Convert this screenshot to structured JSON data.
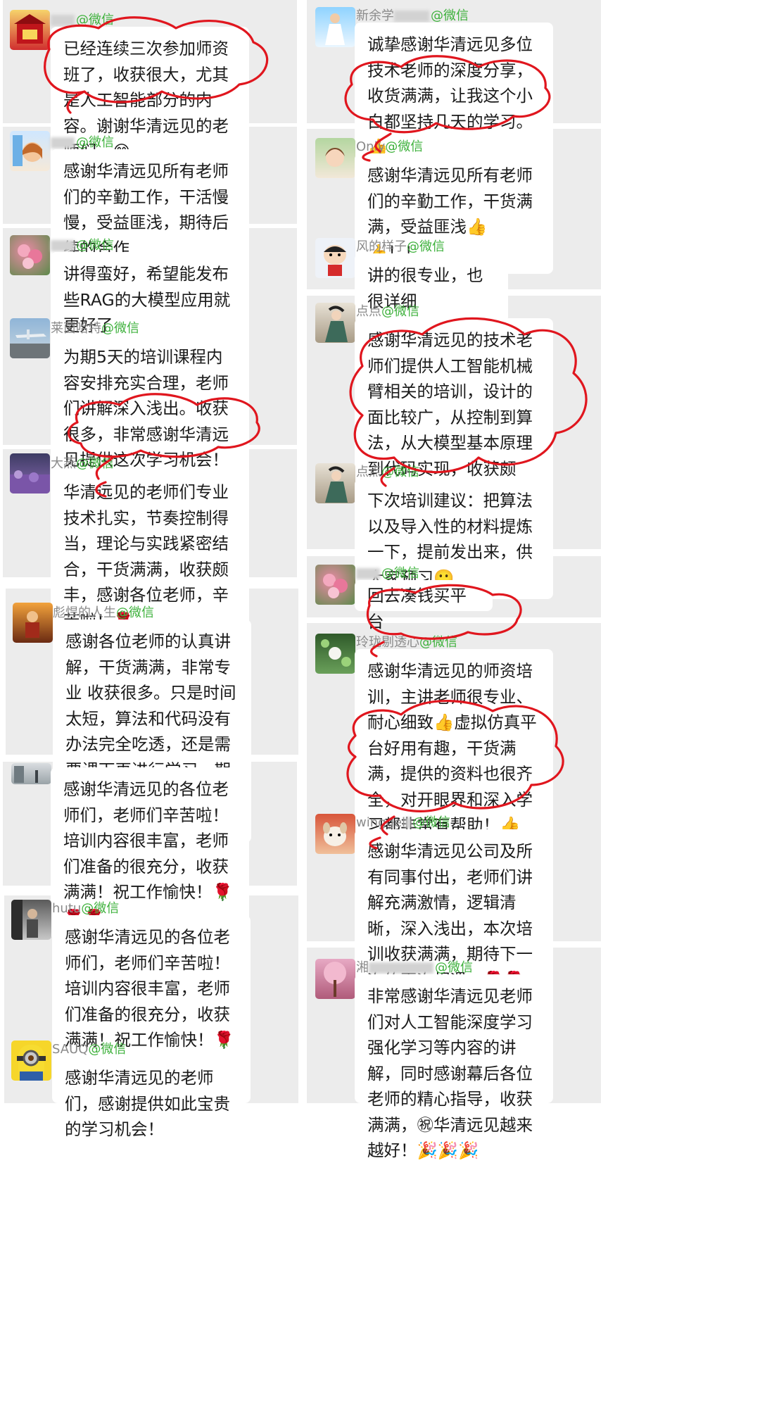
{
  "source_label": "@微信",
  "colors": {
    "panel_bg": "#ececec",
    "bubble_bg": "#ffffff",
    "source_green": "#3eb13c",
    "annotation_red": "#e0161e"
  },
  "left_column": [
    {
      "name": "",
      "avatar": "red-temple-avatar",
      "text": "已经连续三次参加师资班了，收获很大，尤其是人工智能部分的内容。谢谢华清远见的老师们。😁。"
    },
    {
      "name": "",
      "avatar": "anime-girl-avatar",
      "text": "感谢华清远见所有老师们的辛勤工作，干活慢慢，受益匪浅，期待后续的合作"
    },
    {
      "name": "",
      "avatar": "flower-avatar",
      "text": "讲得蛮好，希望能发布些RAG的大模型应用就更好了"
    },
    {
      "name": "莱茵哈特",
      "avatar": "airport-avatar",
      "text": "为期5天的培训课程内容安排充实合理，老师们讲解深入浅出。收获很多，非常感谢华清远见提供这次学习机会！还有令人赞叹的虚拟仿真系统！"
    },
    {
      "name": "大燕",
      "avatar": "lavender-avatar",
      "text": "华清远见的老师们专业技术扎实，节奏控制得当，理论与实践紧密结合，干货满满，收获颇丰，感谢各位老师，辛苦啦！🌹"
    },
    {
      "name": "彪悍的人生",
      "avatar": "warrior-avatar",
      "text": "感谢各位老师的认真讲解，干货满满，非常专业 收获很多。只是时间太短，算法和代码没有办法完全吃透，还是需要课下再进行学习。期待下一次培训！🌹🌹🌹"
    },
    {
      "name": "",
      "avatar": "street-avatar",
      "text": "感谢华清远见的各位老师们，老师们辛苦啦！培训内容很丰富，老师们准备的很充分，收获满满！祝工作愉快！🌹🌹🌹"
    },
    {
      "name": "hutu",
      "avatar": "figure-avatar",
      "text": "感谢华清远见的各位老师们，老师们辛苦啦！培训内容很丰富，老师们准备的很充分，收获满满！祝工作愉快！🌹🌹🌹"
    },
    {
      "name": "SAUQ",
      "avatar": "minion-avatar",
      "text": "感谢华清远见的老师们，感谢提供如此宝贵的学习机会！"
    }
  ],
  "right_column": [
    {
      "name": "新余学",
      "avatar": "girl-sky-avatar",
      "text": "诚挚感谢华清远见多位技术老师的深度分享，收货满满，让我这个小白都坚持几天的学习。👍"
    },
    {
      "name": "Only",
      "avatar": "cartoon-girl-avatar",
      "text": "感谢华清远见所有老师们的辛勤工作，干货满满，受益匪浅👍👍！！"
    },
    {
      "name": "风的样子",
      "avatar": "crayon-shin-avatar",
      "text": "讲的很专业，也很详细"
    },
    {
      "name": "点点",
      "avatar": "hanfu-avatar",
      "text": "感谢华清远见的技术老师们提供人工智能机械臂相关的培训，设计的面比较广，从控制到算法，从大模型基本原理到代码实现，收获颇深，辛苦你们啦👍"
    },
    {
      "name": "点点",
      "avatar": "hanfu-avatar",
      "text": "下次培训建议：把算法以及导入性的材料提炼一下，提前发出来，供大家预习🙂"
    },
    {
      "name": "",
      "avatar": "flower-avatar",
      "text": "回去凑钱买平台"
    },
    {
      "name": "玲珑剔透心",
      "avatar": "leaf-avatar",
      "text": "感谢华清远见的师资培训，主讲老师很专业、耐心细致👍虚拟仿真平台好用有趣，干货满满，提供的资料也很齐全，对开眼界和深入学习都非常有帮助！👍👍👍🧧🎇🎉🌹🌹"
    },
    {
      "name": "winggel",
      "avatar": "dog-avatar",
      "text": "感谢华清远见公司及所有同事付出，老师们讲解充满激情，逻辑清晰，深入浅出，本次培训收获满满，期待下一次的再次相遇。🌹🌹"
    },
    {
      "name": "湘",
      "avatar": "pink-tree-avatar",
      "text": "非常感谢华清远见老师们对人工智能深度学习强化学习等内容的讲解，同时感谢幕后各位老师的精心指导，收获满满，㊗华清远见越来越好！🎉🎉🎉"
    }
  ]
}
